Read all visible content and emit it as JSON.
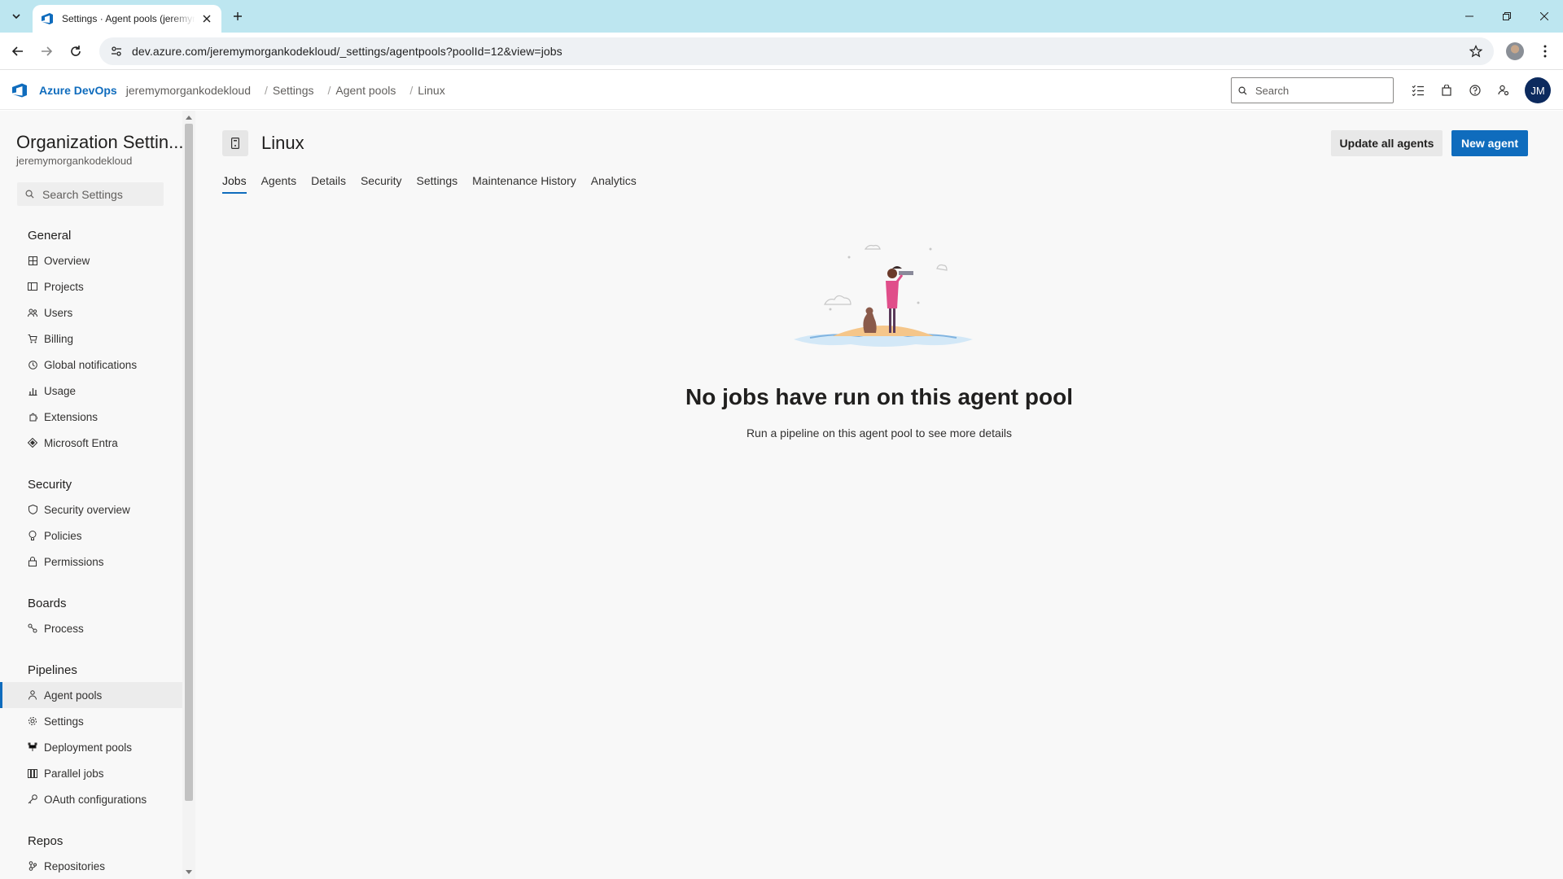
{
  "browser": {
    "tab_title": "Settings · Agent pools (jeremymorgankodekloud)",
    "url": "dev.azure.com/jeremymorgankodekloud/_settings/agentpools?poolId=12&view=jobs"
  },
  "header": {
    "brand": "Azure DevOps",
    "breadcrumbs": [
      "jeremymorgankodekloud",
      "Settings",
      "Agent pools",
      "Linux"
    ],
    "search_placeholder": "Search",
    "avatar_initials": "JM"
  },
  "sidebar": {
    "title": "Organization Settin...",
    "subtitle": "jeremymorgankodekloud",
    "search_placeholder": "Search Settings",
    "sections": [
      {
        "title": "General",
        "items": [
          {
            "label": "Overview",
            "icon": "overview-icon"
          },
          {
            "label": "Projects",
            "icon": "projects-icon"
          },
          {
            "label": "Users",
            "icon": "users-icon"
          },
          {
            "label": "Billing",
            "icon": "billing-icon"
          },
          {
            "label": "Global notifications",
            "icon": "notifications-icon"
          },
          {
            "label": "Usage",
            "icon": "usage-icon"
          },
          {
            "label": "Extensions",
            "icon": "extensions-icon"
          },
          {
            "label": "Microsoft Entra",
            "icon": "entra-icon"
          }
        ]
      },
      {
        "title": "Security",
        "items": [
          {
            "label": "Security overview",
            "icon": "shield-icon"
          },
          {
            "label": "Policies",
            "icon": "policies-icon"
          },
          {
            "label": "Permissions",
            "icon": "lock-icon"
          }
        ]
      },
      {
        "title": "Boards",
        "items": [
          {
            "label": "Process",
            "icon": "process-icon"
          }
        ]
      },
      {
        "title": "Pipelines",
        "items": [
          {
            "label": "Agent pools",
            "icon": "agent-pools-icon",
            "selected": true
          },
          {
            "label": "Settings",
            "icon": "gear-icon"
          },
          {
            "label": "Deployment pools",
            "icon": "deployment-pools-icon"
          },
          {
            "label": "Parallel jobs",
            "icon": "parallel-jobs-icon"
          },
          {
            "label": "OAuth configurations",
            "icon": "oauth-icon"
          }
        ]
      },
      {
        "title": "Repos",
        "items": [
          {
            "label": "Repositories",
            "icon": "repositories-icon"
          }
        ]
      }
    ]
  },
  "main": {
    "pool_name": "Linux",
    "update_button": "Update all agents",
    "new_agent_button": "New agent",
    "tabs": [
      "Jobs",
      "Agents",
      "Details",
      "Security",
      "Settings",
      "Maintenance History",
      "Analytics"
    ],
    "active_tab": "Jobs",
    "empty_title": "No jobs have run on this agent pool",
    "empty_subtitle": "Run a pipeline on this agent pool to see more details"
  },
  "colors": {
    "accent": "#0f6cbd",
    "tabstrip": "#bde6f0",
    "avatar": "#0c2a5e"
  }
}
